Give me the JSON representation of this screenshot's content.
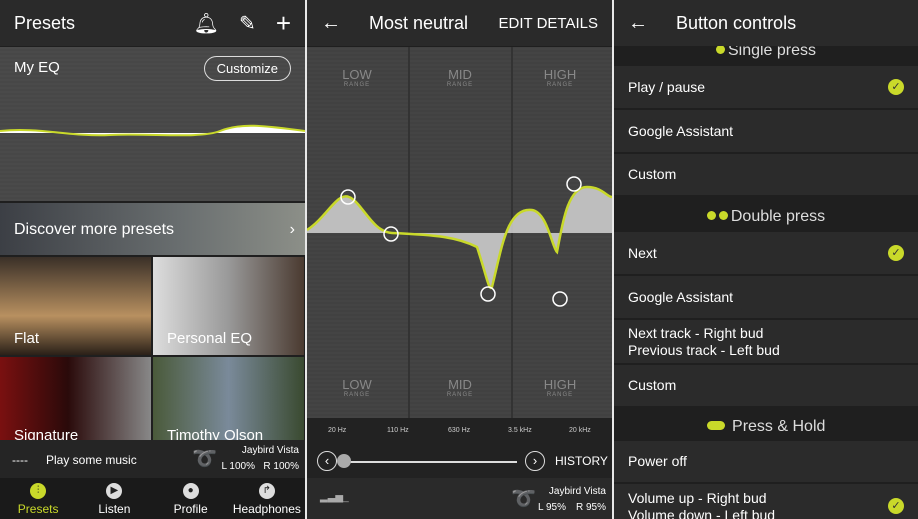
{
  "presets": {
    "title": "Presets",
    "icons": [
      "bell-icon",
      "pencil-icon",
      "plus-icon"
    ],
    "my_eq": "My EQ",
    "customize": "Customize",
    "discover": "Discover more presets",
    "tiles": [
      "Flat",
      "Personal EQ",
      "Signature",
      "Timothy Olson"
    ],
    "player": {
      "dashes": "----",
      "text": "Play some music",
      "device": "Jaybird Vista",
      "left": "L 100%",
      "right": "R 100%"
    },
    "nav": [
      {
        "label": "Presets",
        "active": true
      },
      {
        "label": "Listen"
      },
      {
        "label": "Profile"
      },
      {
        "label": "Headphones"
      }
    ]
  },
  "eq": {
    "title": "Most neutral",
    "edit": "EDIT DETAILS",
    "bands": [
      {
        "name": "LOW",
        "sub": "RANGE"
      },
      {
        "name": "MID",
        "sub": "RANGE"
      },
      {
        "name": "HIGH",
        "sub": "RANGE"
      }
    ],
    "freqs": [
      "20 Hz",
      "110 Hz",
      "630 Hz",
      "3.5 kHz",
      "20 kHz"
    ],
    "history": "HISTORY",
    "device": "Jaybird Vista",
    "left": "L 95%",
    "right": "R 95%"
  },
  "buttons": {
    "title": "Button controls",
    "sections": [
      {
        "title": "Single press",
        "items": [
          {
            "label": "Play / pause",
            "checked": true
          },
          {
            "label": "Google Assistant"
          },
          {
            "label": "Custom"
          }
        ]
      },
      {
        "title": "Double press",
        "items": [
          {
            "label": "Next",
            "checked": true
          },
          {
            "label": "Google Assistant"
          },
          {
            "label": "Next track - Right bud",
            "label2": "Previous track - Left bud"
          },
          {
            "label": "Custom"
          }
        ]
      },
      {
        "title": "Press & Hold",
        "items": [
          {
            "label": "Power off"
          },
          {
            "label": "Volume up - Right bud",
            "label2": "Volume down - Left bud",
            "checked": true
          }
        ]
      }
    ]
  },
  "accent": "#c9d92a"
}
